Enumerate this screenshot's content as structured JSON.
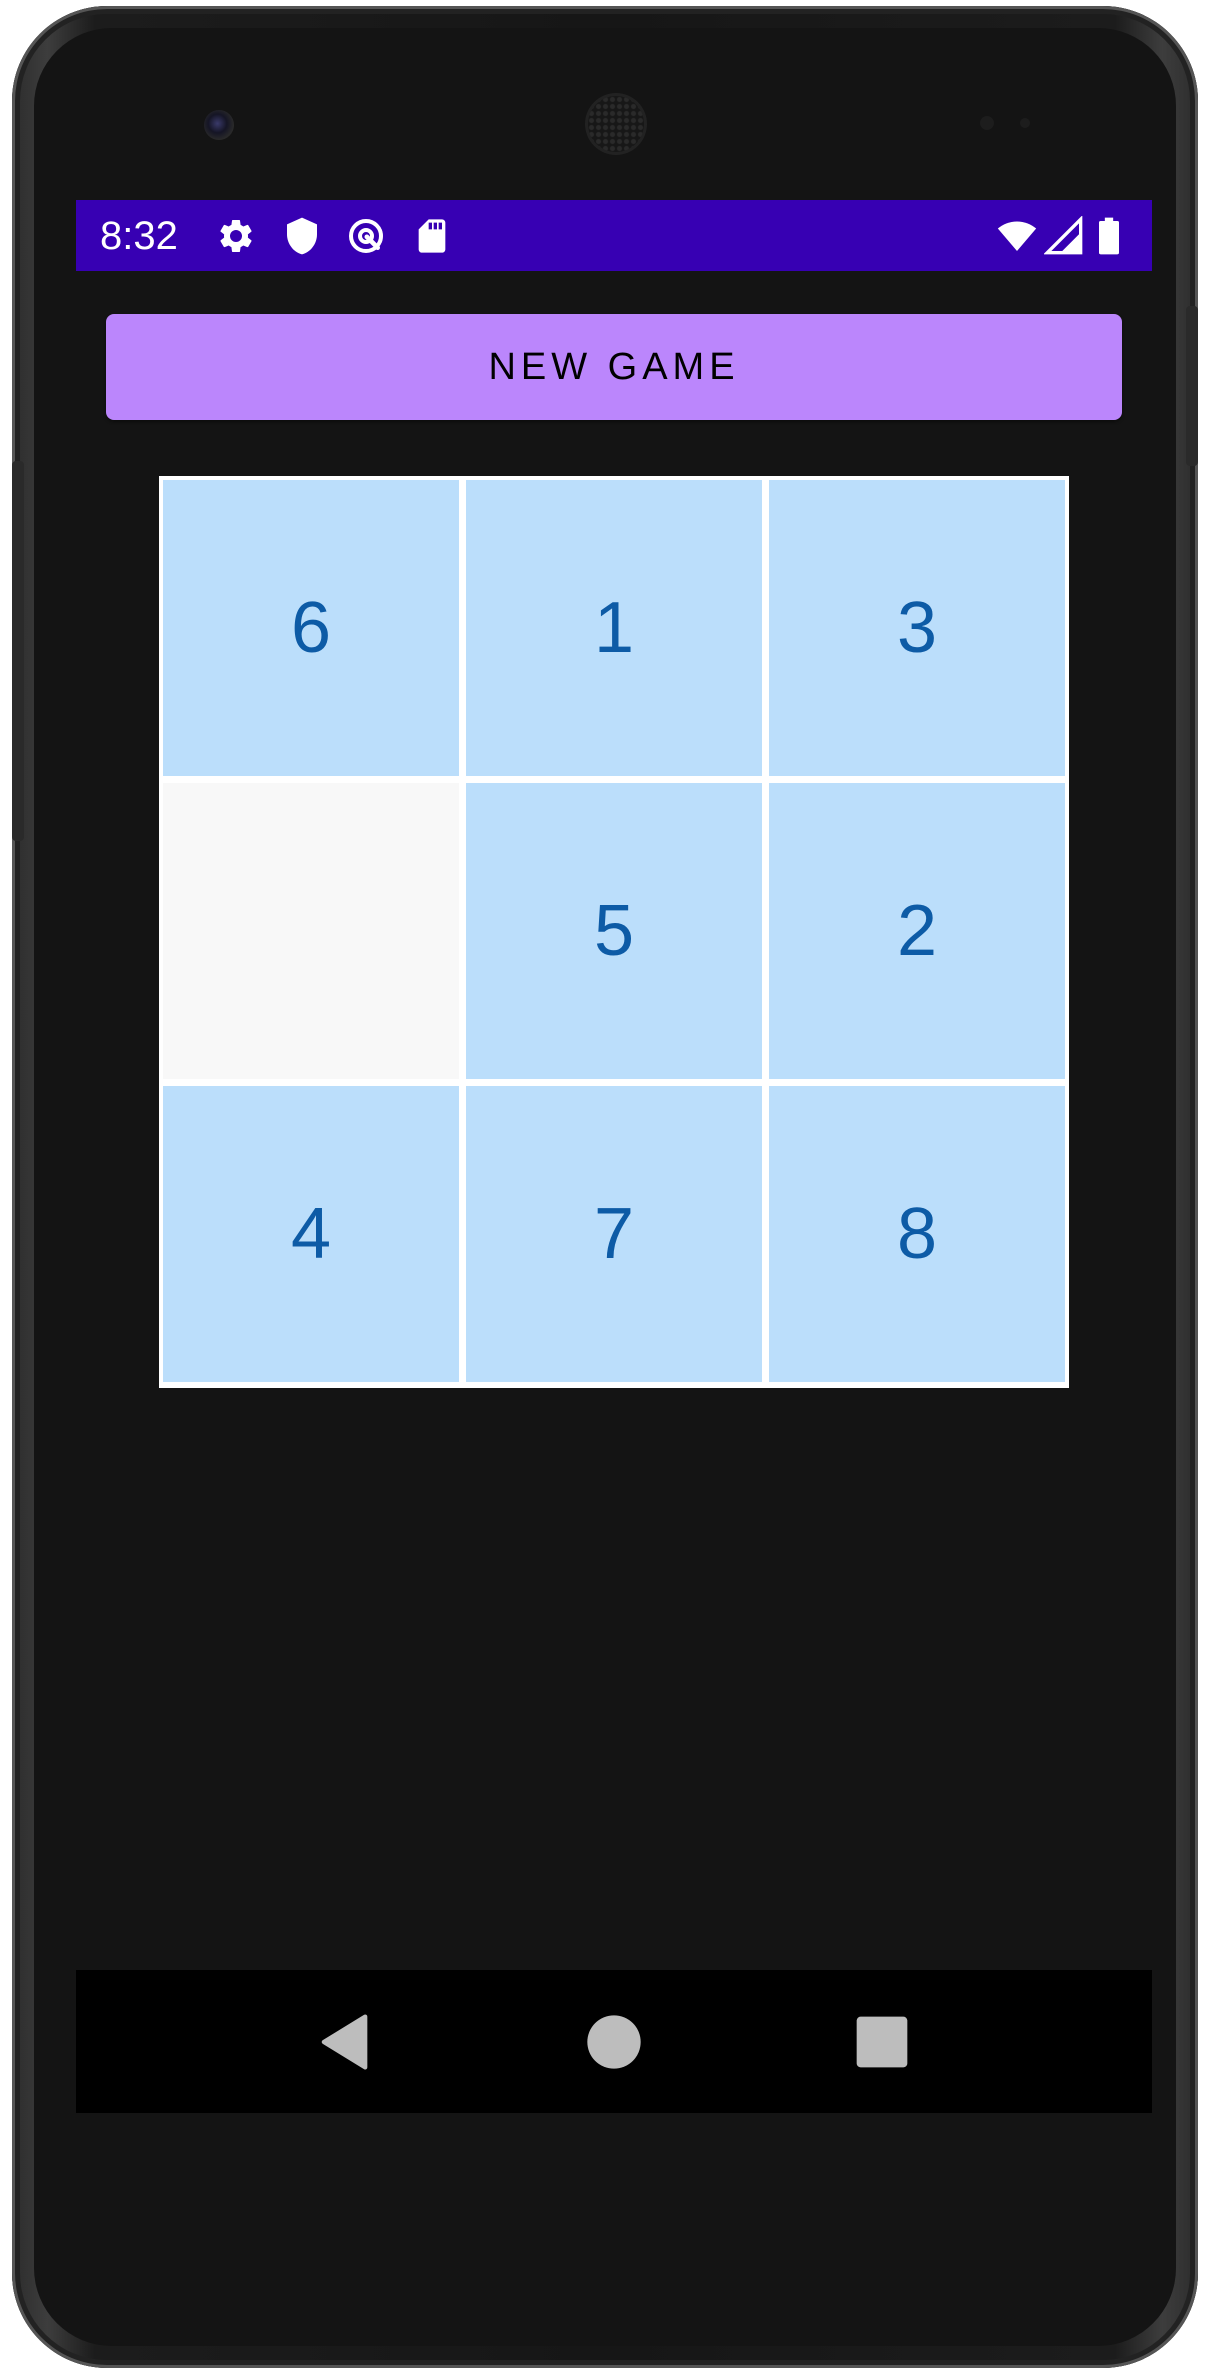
{
  "status_bar": {
    "time": "8:32",
    "background": "#3700b3",
    "left_icons": [
      "settings-gear-icon",
      "shield-icon",
      "vpn-key-icon",
      "sd-card-icon"
    ],
    "right_icons": [
      "wifi-icon",
      "cell-signal-icon",
      "battery-icon"
    ]
  },
  "toolbar": {
    "new_game_label": "NEW GAME",
    "button_color": "#bb86fc"
  },
  "puzzle": {
    "tiles": [
      "6",
      "1",
      "3",
      "",
      "5",
      "2",
      "4",
      "7",
      "8"
    ],
    "tile_color": "#bbdefb",
    "empty_color": "#f8f8f8",
    "number_color": "#0d5ba6"
  },
  "nav_bar": {
    "buttons": [
      "back-icon",
      "home-icon",
      "recents-icon"
    ]
  }
}
